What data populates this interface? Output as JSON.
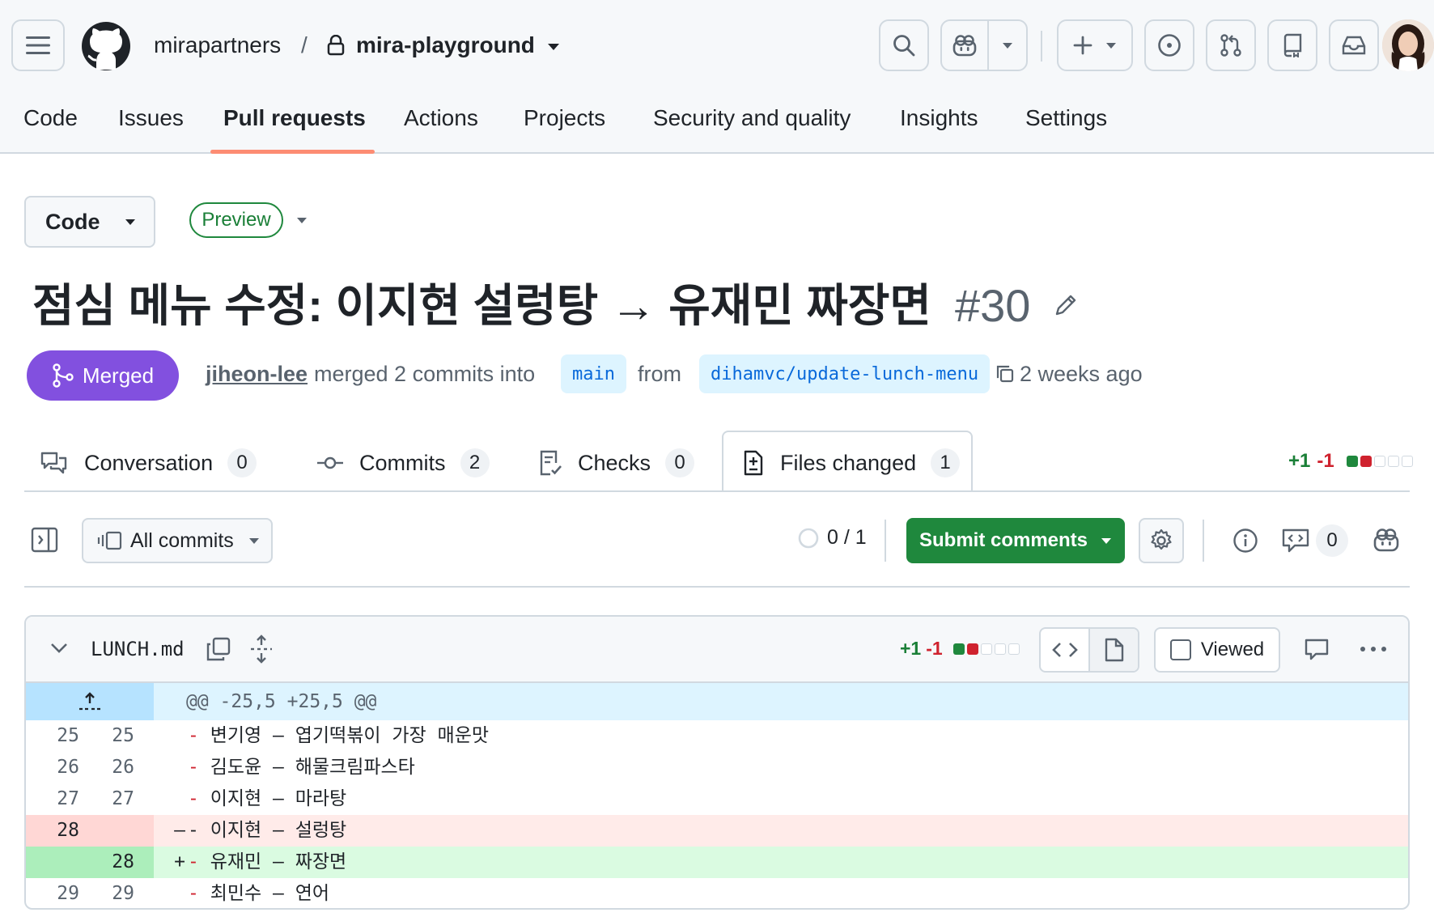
{
  "header": {
    "owner": "mirapartners",
    "separator": "/",
    "repo": "mira-playground"
  },
  "repo_nav": [
    {
      "label": "Code"
    },
    {
      "label": "Issues"
    },
    {
      "label": "Pull requests"
    },
    {
      "label": "Actions"
    },
    {
      "label": "Projects"
    },
    {
      "label": "Security and quality"
    },
    {
      "label": "Insights"
    },
    {
      "label": "Settings"
    }
  ],
  "pr": {
    "code_button": "Code",
    "preview_label": "Preview",
    "title": "점심 메뉴 수정: 이지현 설렁탕 → 유재민 짜장면",
    "number": "#30",
    "state": "Merged",
    "author": "jiheon-lee",
    "merged_text": "merged 2 commits into",
    "base_branch": "main",
    "from_text": "from",
    "head_branch": "dihamvc/update-lunch-menu",
    "time_ago": "2 weeks ago"
  },
  "tabs": [
    {
      "label": "Conversation",
      "count": "0",
      "icon": "comment-discussion-icon"
    },
    {
      "label": "Commits",
      "count": "2",
      "icon": "commit-icon"
    },
    {
      "label": "Checks",
      "count": "0",
      "icon": "checklist-icon"
    },
    {
      "label": "Files changed",
      "count": "1",
      "icon": "file-diff-icon"
    }
  ],
  "diffstat": {
    "additions": "+1",
    "deletions": "-1"
  },
  "toolbar": {
    "commits_filter": "All commits",
    "viewed_progress": "0 / 1",
    "submit_label": "Submit comments",
    "comment_count": "0"
  },
  "file": {
    "name": "LUNCH.md",
    "additions": "+1",
    "deletions": "-1",
    "viewed_label": "Viewed",
    "hunk_header": "@@ -25,5 +25,5 @@",
    "lines": [
      {
        "old": "25",
        "new": "25",
        "type": "context",
        "marker": "",
        "text": "변기영 – 엽기떡볶이 가장 매운맛"
      },
      {
        "old": "26",
        "new": "26",
        "type": "context",
        "marker": "",
        "text": "김도윤 – 해물크림파스타"
      },
      {
        "old": "27",
        "new": "27",
        "type": "context",
        "marker": "",
        "text": "이지현 – 마라탕"
      },
      {
        "old": "28",
        "new": "",
        "type": "deletion",
        "marker": "–",
        "text": "이지현 – 설렁탕"
      },
      {
        "old": "",
        "new": "28",
        "type": "addition",
        "marker": "+",
        "text": "유재민 – 짜장면"
      },
      {
        "old": "29",
        "new": "29",
        "type": "context",
        "marker": "",
        "text": "최민수 – 연어"
      }
    ]
  },
  "colors": {
    "merged": "#8250df",
    "success": "#1f883d",
    "danger": "#cf222e",
    "accent_underline": "#fd8c73",
    "link": "#0969da"
  }
}
